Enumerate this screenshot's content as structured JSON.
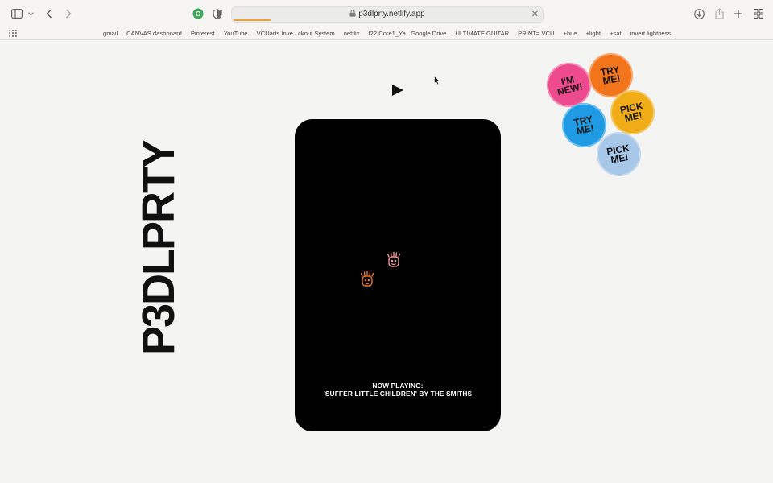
{
  "browser": {
    "url": "p3dlprty.netlify.app",
    "bookmarks": [
      "gmail",
      "CANVAS dashboard",
      "Pinterest",
      "YouTube",
      "VCUarts Inve...ckout System",
      "netflix",
      "f22 Core1_Ya...Google Drive",
      "ULTIMATE GUITAR",
      "PRINT= VCU",
      "+hue",
      "+light",
      "+sat",
      "invert lightness"
    ],
    "tab_close_glyph": "✕"
  },
  "page": {
    "brand": "P3DLPRTY",
    "now_playing_label": "NOW PLAYING:",
    "now_playing_track": "'SUFFER LITTLE CHILDREN' BY THE SMITHS",
    "buttons": [
      {
        "line1": "I'M",
        "line2": "NEW!",
        "color": "#ee4b8f"
      },
      {
        "line1": "TRY",
        "line2": "ME!",
        "color": "#f2751c"
      },
      {
        "line1": "PICK",
        "line2": "ME!",
        "color": "#f0ad18"
      },
      {
        "line1": "TRY",
        "line2": "ME!",
        "color": "#1e9be2"
      },
      {
        "line1": "PICK",
        "line2": "ME!",
        "color": "#a8c8ea"
      }
    ],
    "face_color": "#e8742a",
    "face_color_alt": "#f39b9b"
  }
}
